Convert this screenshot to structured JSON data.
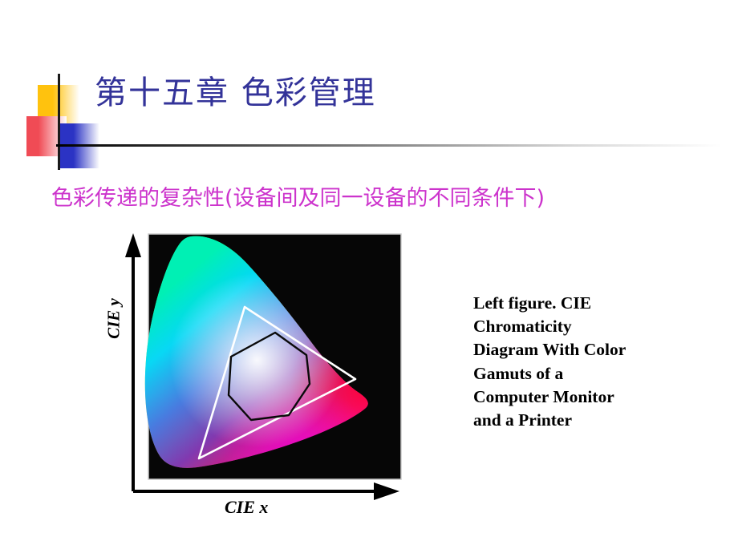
{
  "slide": {
    "title": "第十五章 色彩管理",
    "title_color": "#333399",
    "subtitle": "色彩传递的复杂性(设备间及同一设备的不同条件下)",
    "subtitle_color": "#CC33CC",
    "background_color": "#FFFFFF"
  },
  "decoration": {
    "yellow_color": "#FFC20E",
    "red_color": "#F04B55",
    "blue_color": "#2B33C4",
    "rule_color": "#000000"
  },
  "caption": {
    "lines": [
      "Left figure. CIE",
      "Chromaticity",
      "Diagram With Color",
      "Gamuts of a",
      "Computer Monitor",
      "and a Printer"
    ],
    "text": "Left figure. CIE Chromaticity Diagram With Color Gamuts of a Computer Monitor and a Printer"
  },
  "chart_data": {
    "type": "scatter",
    "title": "CIE Chromaticity Diagram With Color Gamuts of a Computer Monitor and a Printer",
    "xlabel": "CIE x",
    "ylabel": "CIE y",
    "grid": false,
    "legend": "none",
    "plot_background": "#000000",
    "axis_arrows": true,
    "tick_labels": [],
    "xlim": [
      0,
      0.8
    ],
    "ylim": [
      0,
      0.9
    ],
    "series": [
      {
        "name": "Spectral locus (visible gamut)",
        "type": "area",
        "color": "full-spectrum",
        "description": "CIE 1931 horseshoe chromaticity region filled with continuous spectrum colors"
      },
      {
        "name": "Computer Monitor Gamut",
        "type": "polygon",
        "color": "#FFFFFF",
        "vertices": [
          [
            0.3,
            0.6
          ],
          [
            0.64,
            0.33
          ],
          [
            0.15,
            0.06
          ]
        ]
      },
      {
        "name": "Printer Gamut",
        "type": "polygon",
        "color": "#000000",
        "vertices": [
          [
            0.345,
            0.52
          ],
          [
            0.44,
            0.452
          ],
          [
            0.47,
            0.33
          ],
          [
            0.415,
            0.195
          ],
          [
            0.3,
            0.175
          ],
          [
            0.245,
            0.25
          ],
          [
            0.25,
            0.43
          ]
        ]
      }
    ]
  }
}
